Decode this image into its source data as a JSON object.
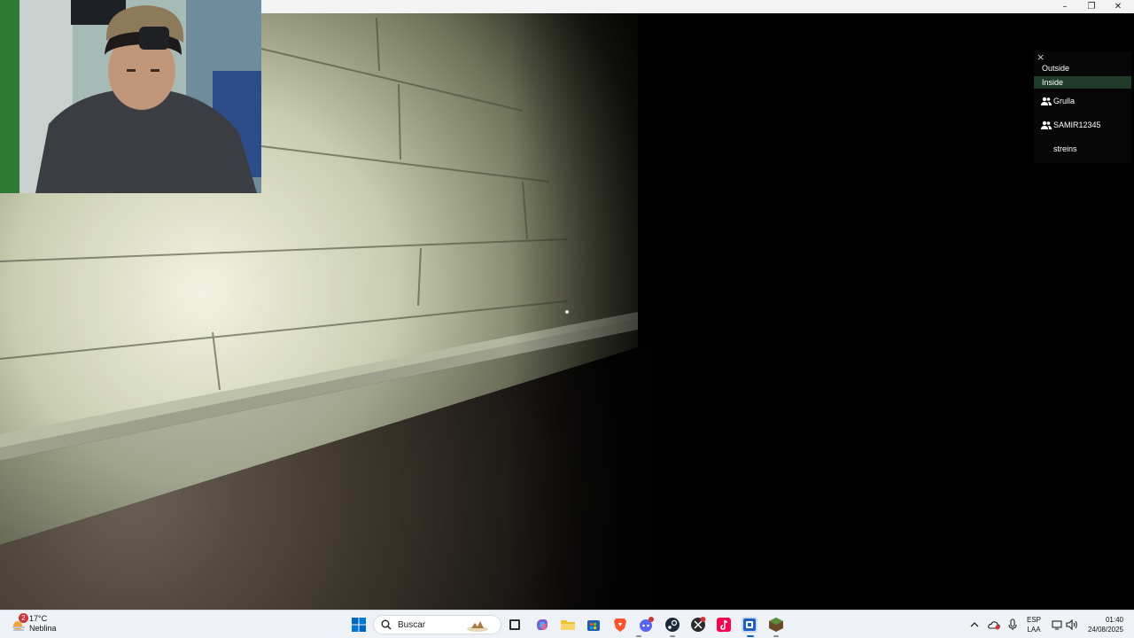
{
  "window": {
    "minimize_glyph": "–",
    "restore_glyph": "❐",
    "close_glyph": "✕"
  },
  "voice_panel": {
    "close_glyph": "×",
    "options": [
      {
        "label": "Outside",
        "active": false
      },
      {
        "label": "Inside",
        "active": true
      }
    ],
    "users": [
      {
        "name": "Grulla",
        "icon": "users-icon"
      },
      {
        "name": "SAMIR12345",
        "icon": "users-icon"
      },
      {
        "name": "streins",
        "icon": null
      }
    ]
  },
  "taskbar": {
    "weather": {
      "temperature": "17°C",
      "condition": "Neblina",
      "badge": "2"
    },
    "search_placeholder": "Buscar",
    "apps": [
      {
        "name": "start-icon",
        "color": "#0067c0"
      },
      {
        "name": "task-view-icon",
        "color": "#2b2b2b"
      },
      {
        "name": "copilot-icon",
        "color": "#7b5cd6"
      },
      {
        "name": "file-explorer-icon",
        "color": "#f2c037"
      },
      {
        "name": "store-icon",
        "color": "#1a5fb4"
      },
      {
        "name": "brave-icon",
        "color": "#fb542b"
      },
      {
        "name": "discord-icon",
        "color": "#5865f2"
      },
      {
        "name": "steam-icon",
        "color": "#1b2838"
      },
      {
        "name": "xbox-icon",
        "color": "#2b2b2b"
      },
      {
        "name": "tiktok-icon",
        "color": "#ff0050"
      },
      {
        "name": "game-launcher-icon",
        "color": "#1f5fbf"
      },
      {
        "name": "minecraft-icon",
        "color": "#6b4a2b"
      }
    ],
    "language": {
      "line1": "ESP",
      "line2": "LAA"
    },
    "clock": {
      "time": "01:40",
      "date": "24/08/2025"
    }
  }
}
